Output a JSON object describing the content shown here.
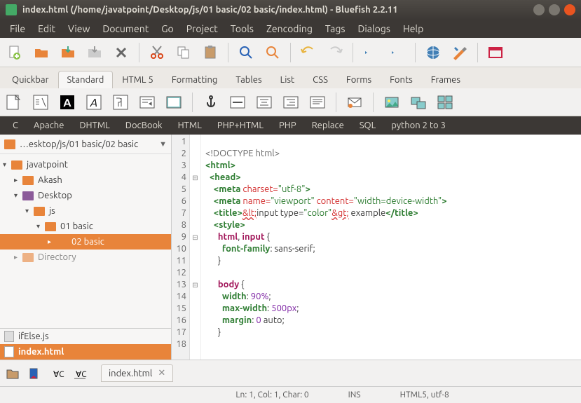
{
  "window": {
    "title": "index.html (/home/javatpoint/Desktop/js/01 basic/02 basic/index.html) - Bluefish 2.2.11"
  },
  "menubar": [
    "File",
    "Edit",
    "View",
    "Document",
    "Go",
    "Project",
    "Tools",
    "Zencoding",
    "Tags",
    "Dialogs",
    "Help"
  ],
  "toolbar_tabs": {
    "items": [
      "Quickbar",
      "Standard",
      "HTML 5",
      "Formatting",
      "Tables",
      "List",
      "CSS",
      "Forms",
      "Fonts",
      "Frames"
    ],
    "active": "Standard"
  },
  "langbar": [
    "C",
    "Apache",
    "DHTML",
    "DocBook",
    "HTML",
    "PHP+HTML",
    "PHP",
    "Replace",
    "SQL",
    "python 2 to 3"
  ],
  "sidebar": {
    "path": "…esktop/js/01 basic/02 basic",
    "tree": [
      {
        "label": "javatpoint",
        "depth": 0,
        "expanded": true,
        "icon": "folder"
      },
      {
        "label": "Akash",
        "depth": 1,
        "expanded": false,
        "icon": "folder"
      },
      {
        "label": "Desktop",
        "depth": 1,
        "expanded": true,
        "icon": "folder-purple"
      },
      {
        "label": "js",
        "depth": 2,
        "expanded": true,
        "icon": "folder"
      },
      {
        "label": "01 basic",
        "depth": 3,
        "expanded": true,
        "icon": "folder"
      },
      {
        "label": "02 basic",
        "depth": 4,
        "expanded": false,
        "icon": "folder",
        "selected": true
      },
      {
        "label": "Directory",
        "depth": 1,
        "expanded": false,
        "icon": "folder",
        "cut": true
      }
    ],
    "files": [
      {
        "label": "ifElse.js",
        "icon": "file-js",
        "selected": false
      },
      {
        "label": "index.html",
        "icon": "file-html",
        "selected": true
      }
    ]
  },
  "editor": {
    "lines": [
      1,
      2,
      3,
      4,
      5,
      6,
      7,
      8,
      9,
      10,
      11,
      12,
      13,
      14,
      15,
      16,
      17,
      18
    ],
    "fold_markers": {
      "4": "⊟",
      "9": "⊟",
      "13": "⊟"
    },
    "code": [
      {
        "indent": 0,
        "parts": [
          {
            "t": "",
            "c": ""
          }
        ]
      },
      {
        "indent": 0,
        "parts": [
          {
            "t": "<!DOCTYPE html>",
            "c": "c-doctype"
          }
        ]
      },
      {
        "indent": 0,
        "parts": [
          {
            "t": "<html>",
            "c": "c-tag"
          }
        ]
      },
      {
        "indent": 1,
        "parts": [
          {
            "t": "<head>",
            "c": "c-tag"
          }
        ]
      },
      {
        "indent": 2,
        "parts": [
          {
            "t": "<meta",
            "c": "c-tag"
          },
          {
            "t": " charset=",
            "c": "c-attr"
          },
          {
            "t": "\"utf-8\"",
            "c": "c-str"
          },
          {
            "t": ">",
            "c": "c-tag"
          }
        ]
      },
      {
        "indent": 2,
        "parts": [
          {
            "t": "<meta",
            "c": "c-tag"
          },
          {
            "t": " name=",
            "c": "c-attr"
          },
          {
            "t": "\"viewport\"",
            "c": "c-str"
          },
          {
            "t": " content=",
            "c": "c-attr"
          },
          {
            "t": "\"width=device-width\"",
            "c": "c-str"
          },
          {
            "t": ">",
            "c": "c-tag"
          }
        ]
      },
      {
        "indent": 2,
        "parts": [
          {
            "t": "<title>",
            "c": "c-tag"
          },
          {
            "t": "&lt;",
            "c": "c-err"
          },
          {
            "t": "input type=",
            "c": ""
          },
          {
            "t": "\"color\"",
            "c": "c-str"
          },
          {
            "t": "&gt;",
            "c": "c-err"
          },
          {
            "t": " example",
            "c": ""
          },
          {
            "t": "</title>",
            "c": "c-tag"
          }
        ]
      },
      {
        "indent": 2,
        "parts": [
          {
            "t": "<style>",
            "c": "c-tag"
          }
        ]
      },
      {
        "indent": 3,
        "parts": [
          {
            "t": "html",
            "c": "c-sel"
          },
          {
            "t": ", ",
            "c": ""
          },
          {
            "t": "input",
            "c": "c-sel"
          },
          {
            "t": " {",
            "c": ""
          }
        ]
      },
      {
        "indent": 4,
        "parts": [
          {
            "t": "font-family",
            "c": "c-prop"
          },
          {
            "t": ": sans-serif;",
            "c": "c-val"
          }
        ]
      },
      {
        "indent": 3,
        "parts": [
          {
            "t": "}",
            "c": ""
          }
        ]
      },
      {
        "indent": 0,
        "parts": [
          {
            "t": "",
            "c": ""
          }
        ]
      },
      {
        "indent": 3,
        "parts": [
          {
            "t": "body",
            "c": "c-sel"
          },
          {
            "t": " {",
            "c": ""
          }
        ]
      },
      {
        "indent": 4,
        "parts": [
          {
            "t": "width",
            "c": "c-prop"
          },
          {
            "t": ": ",
            "c": ""
          },
          {
            "t": "90%",
            "c": "c-num"
          },
          {
            "t": ";",
            "c": ""
          }
        ]
      },
      {
        "indent": 4,
        "parts": [
          {
            "t": "max-width",
            "c": "c-prop"
          },
          {
            "t": ": ",
            "c": ""
          },
          {
            "t": "500px",
            "c": "c-num"
          },
          {
            "t": ";",
            "c": ""
          }
        ]
      },
      {
        "indent": 4,
        "parts": [
          {
            "t": "margin",
            "c": "c-prop"
          },
          {
            "t": ": ",
            "c": ""
          },
          {
            "t": "0",
            "c": "c-num"
          },
          {
            "t": " auto;",
            "c": ""
          }
        ]
      },
      {
        "indent": 3,
        "parts": [
          {
            "t": "}",
            "c": ""
          }
        ]
      },
      {
        "indent": 0,
        "parts": [
          {
            "t": "",
            "c": ""
          }
        ]
      }
    ]
  },
  "open_file_tab": "index.html",
  "statusbar": {
    "position": "Ln: 1, Col: 1, Char: 0",
    "insert_mode": "INS",
    "doctype": "HTML5, utf-8"
  }
}
